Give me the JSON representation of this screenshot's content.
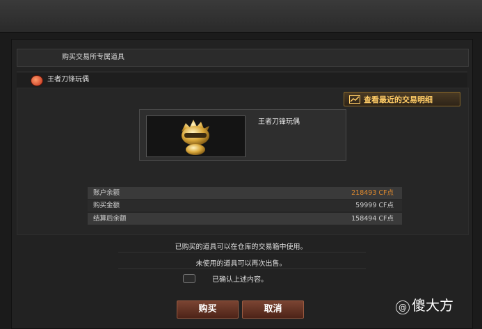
{
  "dialog": {
    "header_title": "购买交易所专属道具",
    "item_name": "王者刀锋玩偶",
    "trade_button_label": "查看最近的交易明细",
    "card_item_name": "王者刀锋玩偶"
  },
  "summary": [
    {
      "label": "账户余额",
      "value": "218493 CF点"
    },
    {
      "label": "购买金额",
      "value": "59999 CF点"
    },
    {
      "label": "结算后余额",
      "value": "158494 CF点"
    }
  ],
  "notes": {
    "line1": "已购买的道具可以在仓库的交易箱中使用。",
    "line2": "未使用的道具可以再次出售。",
    "confirm": "已确认上述内容。"
  },
  "buttons": {
    "buy": "购买",
    "cancel": "取消"
  },
  "watermark": {
    "prefix": "@",
    "text": "傻大方"
  },
  "icons": [
    "item-badge-icon",
    "chart-icon",
    "character-doll-image"
  ],
  "colors": {
    "balance_highlight": "#e08a2e",
    "button_bg": "#7a4432",
    "trade_button_text": "#ffcc66"
  }
}
